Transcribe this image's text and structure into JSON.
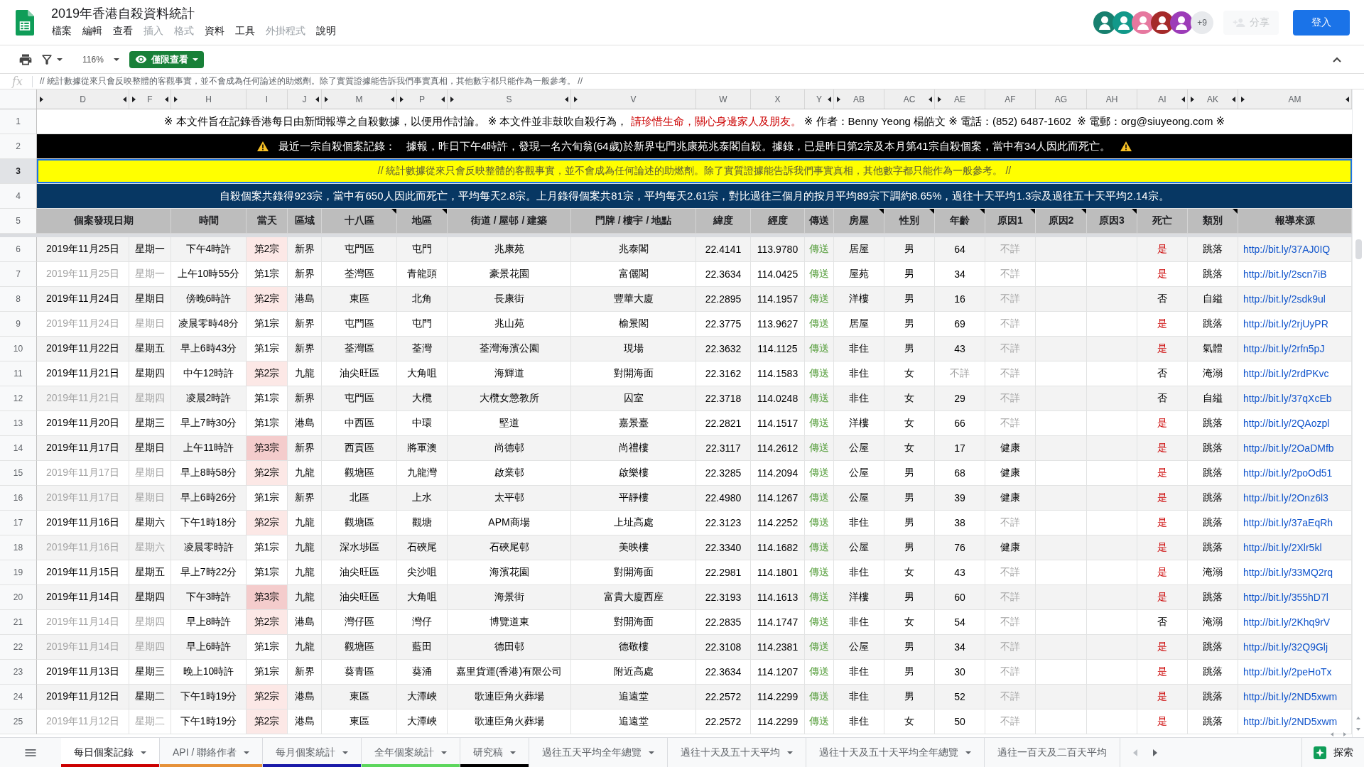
{
  "window": {
    "title": "2019年香港自殺資料統計"
  },
  "menu": [
    {
      "label": "檔案",
      "disabled": false
    },
    {
      "label": "編輯",
      "disabled": false
    },
    {
      "label": "查看",
      "disabled": false
    },
    {
      "label": "插入",
      "disabled": true
    },
    {
      "label": "格式",
      "disabled": true
    },
    {
      "label": "資料",
      "disabled": false
    },
    {
      "label": "工具",
      "disabled": false
    },
    {
      "label": "外掛程式",
      "disabled": true
    },
    {
      "label": "說明",
      "disabled": false
    }
  ],
  "account_bar": {
    "avatars": [
      {
        "color": "#17806f"
      },
      {
        "color": "#12998a"
      },
      {
        "color": "#e6789f"
      },
      {
        "color": "#a52a2a"
      },
      {
        "color": "#9c3cb8"
      }
    ],
    "more_viewers": "+9",
    "share": {
      "label": "分享",
      "disabled": true
    },
    "sign_in": {
      "label": "登入"
    }
  },
  "toolbar": {
    "zoom": "116%",
    "view_mode": "僅限查看"
  },
  "formula_bar": {
    "label": "fx",
    "value": "// 統計數據從來只會反映整體的客觀事實，並不會成為任何論述的助燃劑。除了實質證據能告訴我們事實真相，其他數字都只能作為一般參考。 //"
  },
  "column_headers": [
    {
      "letter": "D",
      "hidden_before": true,
      "hidden_after": true
    },
    {
      "letter": "F",
      "hidden_before": true,
      "hidden_after": true
    },
    {
      "letter": "H",
      "hidden_before": true,
      "hidden_after": false
    },
    {
      "letter": "I",
      "hidden_before": false,
      "hidden_after": false
    },
    {
      "letter": "J",
      "hidden_before": false,
      "hidden_after": true
    },
    {
      "letter": "M",
      "hidden_before": true,
      "hidden_after": true
    },
    {
      "letter": "P",
      "hidden_before": true,
      "hidden_after": true
    },
    {
      "letter": "S",
      "hidden_before": true,
      "hidden_after": true
    },
    {
      "letter": "V",
      "hidden_before": true,
      "hidden_after": false
    },
    {
      "letter": "W",
      "hidden_before": false,
      "hidden_after": false
    },
    {
      "letter": "X",
      "hidden_before": false,
      "hidden_after": false
    },
    {
      "letter": "Y",
      "hidden_before": false,
      "hidden_after": true
    },
    {
      "letter": "AB",
      "hidden_before": true,
      "hidden_after": false
    },
    {
      "letter": "AC",
      "hidden_before": false,
      "hidden_after": true
    },
    {
      "letter": "AE",
      "hidden_before": true,
      "hidden_after": false
    },
    {
      "letter": "AF",
      "hidden_before": false,
      "hidden_after": false
    },
    {
      "letter": "AG",
      "hidden_before": false,
      "hidden_after": false
    },
    {
      "letter": "AH",
      "hidden_before": false,
      "hidden_after": false
    },
    {
      "letter": "AI",
      "hidden_before": false,
      "hidden_after": true
    },
    {
      "letter": "AK",
      "hidden_before": true,
      "hidden_after": true
    },
    {
      "letter": "AM",
      "hidden_before": true,
      "hidden_after": true
    }
  ],
  "banner_rows": [
    {
      "number": "1",
      "kind": "notice",
      "selected": false,
      "segments": [
        {
          "text": "※ 本文件旨在記錄香港每日由新聞報導之自殺數據，以便用作討論。 ※ 本文件並非鼓吹自殺行為， ",
          "emphasis": false
        },
        {
          "text": "請珍惜生命，關心身邊家人及朋友。",
          "emphasis": true
        },
        {
          "text": " ※ 作者：Benny Yeong 楊皓文 ※ 電話：(852) 6487-1602  ※ 電郵：org@siuyeong.com ※",
          "emphasis": false
        }
      ]
    },
    {
      "number": "2",
      "kind": "alert",
      "selected": false,
      "segments": [
        {
          "text": "最近一宗自殺個案記錄：　據報，昨日下午4時許，發現一名六旬翁(64歲)於新界屯門兆康苑兆泰閣自殺。據錄，已是昨日第2宗及本月第41宗自殺個案，當中有34人因此而死亡。",
          "emphasis": false
        }
      ]
    },
    {
      "number": "3",
      "kind": "disclaimer",
      "selected": true,
      "segments": [
        {
          "text": "// 統計數據從來只會反映整體的客觀事實，並不會成為任何論述的助燃劑。除了實質證據能告訴我們事實真相，其他數字都只能作為一般參考。 //",
          "emphasis": false
        }
      ]
    },
    {
      "number": "4",
      "kind": "summary",
      "selected": false,
      "segments": [
        {
          "text": "自殺個案共錄得923宗，當中有650人因此而死亡，平均每天2.8宗。上月錄得個案共81宗，平均每天2.61宗，對比過往三個月的按月平均89宗下調約8.65%，過往十天平均1.3宗及過往五十天平均2.14宗。",
          "emphasis": false
        }
      ]
    }
  ],
  "header_row": {
    "number": "5",
    "cells": [
      {
        "label": "個案發現日期",
        "note": false
      },
      {
        "label": "時間",
        "note": false
      },
      {
        "label": "當天",
        "note": false
      },
      {
        "label": "區域",
        "note": false
      },
      {
        "label": "十八區",
        "note": true
      },
      {
        "label": "地區",
        "note": true
      },
      {
        "label": "街道 / 屋邨 / 建築",
        "note": false
      },
      {
        "label": "門牌 / 樓宇 / 地點",
        "note": false
      },
      {
        "label": "緯度",
        "note": false
      },
      {
        "label": "經度",
        "note": false
      },
      {
        "label": "傳送",
        "note": false
      },
      {
        "label": "房屋",
        "note": true
      },
      {
        "label": "性別",
        "note": true
      },
      {
        "label": "年齡",
        "note": true
      },
      {
        "label": "原因1",
        "note": true
      },
      {
        "label": "原因2",
        "note": true
      },
      {
        "label": "原因3",
        "note": true
      },
      {
        "label": "死亡",
        "note": false
      },
      {
        "label": "類別",
        "note": true
      },
      {
        "label": "報導來源",
        "note": false
      }
    ]
  },
  "rows": [
    {
      "number": "6",
      "date": "2019年11月25日",
      "weekday": "星期一",
      "repeat_date": false,
      "time": "下午4時許",
      "case": {
        "text": "第2宗",
        "color": "#fce8e6"
      },
      "region": "新界",
      "district": "屯門區",
      "area": "屯門",
      "street": "兆康苑",
      "building": "兆泰閣",
      "lat": "22.4141",
      "lon": "113.9780",
      "transfer": "傳送",
      "housing": "居屋",
      "sex": "男",
      "age": "64",
      "age_unknown": false,
      "cause1": "不詳",
      "cause1_unknown": true,
      "death": "是",
      "death_marked": true,
      "type": "跳落",
      "source": "http://bit.ly/37AJ0IQ"
    },
    {
      "number": "7",
      "date": "2019年11月25日",
      "weekday": "星期一",
      "repeat_date": true,
      "time": "上午10時55分",
      "case": {
        "text": "第1宗",
        "color": "#ffffff"
      },
      "region": "新界",
      "district": "荃灣區",
      "area": "青龍頭",
      "street": "豪景花園",
      "building": "富儷閣",
      "lat": "22.3634",
      "lon": "114.0425",
      "transfer": "傳送",
      "housing": "屋苑",
      "sex": "男",
      "age": "34",
      "age_unknown": false,
      "cause1": "不詳",
      "cause1_unknown": true,
      "death": "是",
      "death_marked": true,
      "type": "跳落",
      "source": "http://bit.ly/2scn7iB"
    },
    {
      "number": "8",
      "date": "2019年11月24日",
      "weekday": "星期日",
      "repeat_date": false,
      "time": "傍晚6時許",
      "case": {
        "text": "第2宗",
        "color": "#fce8e6"
      },
      "region": "港島",
      "district": "東區",
      "area": "北角",
      "street": "長康街",
      "building": "豐華大廈",
      "lat": "22.2895",
      "lon": "114.1957",
      "transfer": "傳送",
      "housing": "洋樓",
      "sex": "男",
      "age": "16",
      "age_unknown": false,
      "cause1": "不詳",
      "cause1_unknown": true,
      "death": "否",
      "death_marked": false,
      "type": "自縊",
      "source": "http://bit.ly/2sdk9ul"
    },
    {
      "number": "9",
      "date": "2019年11月24日",
      "weekday": "星期日",
      "repeat_date": true,
      "time": "凌晨零時48分",
      "case": {
        "text": "第1宗",
        "color": "#ffffff"
      },
      "region": "新界",
      "district": "屯門區",
      "area": "屯門",
      "street": "兆山苑",
      "building": "榆景閣",
      "lat": "22.3775",
      "lon": "113.9627",
      "transfer": "傳送",
      "housing": "居屋",
      "sex": "男",
      "age": "69",
      "age_unknown": false,
      "cause1": "不詳",
      "cause1_unknown": true,
      "death": "是",
      "death_marked": true,
      "type": "跳落",
      "source": "http://bit.ly/2rjUyPR"
    },
    {
      "number": "10",
      "date": "2019年11月22日",
      "weekday": "星期五",
      "repeat_date": false,
      "time": "早上6時43分",
      "case": {
        "text": "第1宗",
        "color": "#ffffff"
      },
      "region": "新界",
      "district": "荃灣區",
      "area": "荃灣",
      "street": "荃灣海濱公園",
      "building": "現場",
      "lat": "22.3632",
      "lon": "114.1125",
      "transfer": "傳送",
      "housing": "非住",
      "sex": "男",
      "age": "43",
      "age_unknown": false,
      "cause1": "不詳",
      "cause1_unknown": true,
      "death": "是",
      "death_marked": true,
      "type": "氣體",
      "source": "http://bit.ly/2rfn5pJ"
    },
    {
      "number": "11",
      "date": "2019年11月21日",
      "weekday": "星期四",
      "repeat_date": false,
      "time": "中午12時許",
      "case": {
        "text": "第2宗",
        "color": "#fce8e6"
      },
      "region": "九龍",
      "district": "油尖旺區",
      "area": "大角咀",
      "street": "海輝道",
      "building": "對開海面",
      "lat": "22.3162",
      "lon": "114.1583",
      "transfer": "傳送",
      "housing": "非住",
      "sex": "女",
      "age": "不詳",
      "age_unknown": true,
      "cause1": "不詳",
      "cause1_unknown": true,
      "death": "否",
      "death_marked": false,
      "type": "淹溺",
      "source": "http://bit.ly/2rdPKvc"
    },
    {
      "number": "12",
      "date": "2019年11月21日",
      "weekday": "星期四",
      "repeat_date": true,
      "time": "凌晨2時許",
      "case": {
        "text": "第1宗",
        "color": "#ffffff"
      },
      "region": "新界",
      "district": "屯門區",
      "area": "大欖",
      "street": "大欖女懲教所",
      "building": "囚室",
      "lat": "22.3718",
      "lon": "114.0248",
      "transfer": "傳送",
      "housing": "非住",
      "sex": "女",
      "age": "29",
      "age_unknown": false,
      "cause1": "不詳",
      "cause1_unknown": true,
      "death": "否",
      "death_marked": false,
      "type": "自縊",
      "source": "http://bit.ly/37qXcEb"
    },
    {
      "number": "13",
      "date": "2019年11月20日",
      "weekday": "星期三",
      "repeat_date": false,
      "time": "早上7時30分",
      "case": {
        "text": "第1宗",
        "color": "#ffffff"
      },
      "region": "港島",
      "district": "中西區",
      "area": "中環",
      "street": "堅道",
      "building": "嘉景臺",
      "lat": "22.2821",
      "lon": "114.1517",
      "transfer": "傳送",
      "housing": "洋樓",
      "sex": "女",
      "age": "66",
      "age_unknown": false,
      "cause1": "不詳",
      "cause1_unknown": true,
      "death": "是",
      "death_marked": true,
      "type": "跳落",
      "source": "http://bit.ly/2QAozpl"
    },
    {
      "number": "14",
      "date": "2019年11月17日",
      "weekday": "星期日",
      "repeat_date": false,
      "time": "上午11時許",
      "case": {
        "text": "第3宗",
        "color": "#f4cccc"
      },
      "region": "新界",
      "district": "西貢區",
      "area": "將軍澳",
      "street": "尚德邨",
      "building": "尚禮樓",
      "lat": "22.3117",
      "lon": "114.2612",
      "transfer": "傳送",
      "housing": "公屋",
      "sex": "女",
      "age": "17",
      "age_unknown": false,
      "cause1": "健康",
      "cause1_unknown": false,
      "death": "是",
      "death_marked": true,
      "type": "跳落",
      "source": "http://bit.ly/2OaDMfb"
    },
    {
      "number": "15",
      "date": "2019年11月17日",
      "weekday": "星期日",
      "repeat_date": true,
      "time": "早上8時58分",
      "case": {
        "text": "第2宗",
        "color": "#fce8e6"
      },
      "region": "九龍",
      "district": "觀塘區",
      "area": "九龍灣",
      "street": "啟業邨",
      "building": "啟樂樓",
      "lat": "22.3285",
      "lon": "114.2094",
      "transfer": "傳送",
      "housing": "公屋",
      "sex": "男",
      "age": "68",
      "age_unknown": false,
      "cause1": "健康",
      "cause1_unknown": false,
      "death": "是",
      "death_marked": true,
      "type": "跳落",
      "source": "http://bit.ly/2poOd51"
    },
    {
      "number": "16",
      "date": "2019年11月17日",
      "weekday": "星期日",
      "repeat_date": true,
      "time": "早上6時26分",
      "case": {
        "text": "第1宗",
        "color": "#ffffff"
      },
      "region": "新界",
      "district": "北區",
      "area": "上水",
      "street": "太平邨",
      "building": "平靜樓",
      "lat": "22.4980",
      "lon": "114.1267",
      "transfer": "傳送",
      "housing": "公屋",
      "sex": "男",
      "age": "39",
      "age_unknown": false,
      "cause1": "健康",
      "cause1_unknown": false,
      "death": "是",
      "death_marked": true,
      "type": "跳落",
      "source": "http://bit.ly/2Onz6l3"
    },
    {
      "number": "17",
      "date": "2019年11月16日",
      "weekday": "星期六",
      "repeat_date": false,
      "time": "下午1時18分",
      "case": {
        "text": "第2宗",
        "color": "#fce8e6"
      },
      "region": "九龍",
      "district": "觀塘區",
      "area": "觀塘",
      "street": "APM商場",
      "building": "上址高處",
      "lat": "22.3123",
      "lon": "114.2252",
      "transfer": "傳送",
      "housing": "非住",
      "sex": "男",
      "age": "38",
      "age_unknown": false,
      "cause1": "不詳",
      "cause1_unknown": true,
      "death": "是",
      "death_marked": true,
      "type": "跳落",
      "source": "http://bit.ly/37aEqRh"
    },
    {
      "number": "18",
      "date": "2019年11月16日",
      "weekday": "星期六",
      "repeat_date": true,
      "time": "凌晨零時許",
      "case": {
        "text": "第1宗",
        "color": "#ffffff"
      },
      "region": "九龍",
      "district": "深水埗區",
      "area": "石硤尾",
      "street": "石硤尾邨",
      "building": "美映樓",
      "lat": "22.3340",
      "lon": "114.1682",
      "transfer": "傳送",
      "housing": "公屋",
      "sex": "男",
      "age": "76",
      "age_unknown": false,
      "cause1": "健康",
      "cause1_unknown": false,
      "death": "是",
      "death_marked": true,
      "type": "跳落",
      "source": "http://bit.ly/2Xlr5kl"
    },
    {
      "number": "19",
      "date": "2019年11月15日",
      "weekday": "星期五",
      "repeat_date": false,
      "time": "早上7時22分",
      "case": {
        "text": "第1宗",
        "color": "#ffffff"
      },
      "region": "九龍",
      "district": "油尖旺區",
      "area": "尖沙咀",
      "street": "海濱花園",
      "building": "對開海面",
      "lat": "22.2981",
      "lon": "114.1801",
      "transfer": "傳送",
      "housing": "非住",
      "sex": "女",
      "age": "43",
      "age_unknown": false,
      "cause1": "不詳",
      "cause1_unknown": true,
      "death": "是",
      "death_marked": true,
      "type": "淹溺",
      "source": "http://bit.ly/33MQ2rq"
    },
    {
      "number": "20",
      "date": "2019年11月14日",
      "weekday": "星期四",
      "repeat_date": false,
      "time": "下午3時許",
      "case": {
        "text": "第3宗",
        "color": "#f4cccc"
      },
      "region": "九龍",
      "district": "油尖旺區",
      "area": "大角咀",
      "street": "海景街",
      "building": "富貴大廈西座",
      "lat": "22.3193",
      "lon": "114.1613",
      "transfer": "傳送",
      "housing": "洋樓",
      "sex": "男",
      "age": "60",
      "age_unknown": false,
      "cause1": "不詳",
      "cause1_unknown": true,
      "death": "是",
      "death_marked": true,
      "type": "跳落",
      "source": "http://bit.ly/355hD7l"
    },
    {
      "number": "21",
      "date": "2019年11月14日",
      "weekday": "星期四",
      "repeat_date": true,
      "time": "早上8時許",
      "case": {
        "text": "第2宗",
        "color": "#fce8e6"
      },
      "region": "港島",
      "district": "灣仔區",
      "area": "灣仔",
      "street": "博覽道東",
      "building": "對開海面",
      "lat": "22.2835",
      "lon": "114.1747",
      "transfer": "傳送",
      "housing": "非住",
      "sex": "女",
      "age": "54",
      "age_unknown": false,
      "cause1": "不詳",
      "cause1_unknown": true,
      "death": "否",
      "death_marked": false,
      "type": "淹溺",
      "source": "http://bit.ly/2Khq9rV"
    },
    {
      "number": "22",
      "date": "2019年11月14日",
      "weekday": "星期四",
      "repeat_date": true,
      "time": "早上6時許",
      "case": {
        "text": "第1宗",
        "color": "#ffffff"
      },
      "region": "九龍",
      "district": "觀塘區",
      "area": "藍田",
      "street": "德田邨",
      "building": "德敬樓",
      "lat": "22.3108",
      "lon": "114.2381",
      "transfer": "傳送",
      "housing": "公屋",
      "sex": "男",
      "age": "34",
      "age_unknown": false,
      "cause1": "不詳",
      "cause1_unknown": true,
      "death": "是",
      "death_marked": true,
      "type": "跳落",
      "source": "http://bit.ly/32Q9Glj"
    },
    {
      "number": "23",
      "date": "2019年11月13日",
      "weekday": "星期三",
      "repeat_date": false,
      "time": "晚上10時許",
      "case": {
        "text": "第1宗",
        "color": "#ffffff"
      },
      "region": "新界",
      "district": "葵青區",
      "area": "葵涌",
      "street": "嘉里貨運(香港)有限公司",
      "building": "附近高處",
      "lat": "22.3634",
      "lon": "114.1207",
      "transfer": "傳送",
      "housing": "非住",
      "sex": "男",
      "age": "30",
      "age_unknown": false,
      "cause1": "不詳",
      "cause1_unknown": true,
      "death": "是",
      "death_marked": true,
      "type": "跳落",
      "source": "http://bit.ly/2peHoTx"
    },
    {
      "number": "24",
      "date": "2019年11月12日",
      "weekday": "星期二",
      "repeat_date": false,
      "time": "下午1時19分",
      "case": {
        "text": "第2宗",
        "color": "#fce8e6"
      },
      "region": "港島",
      "district": "東區",
      "area": "大潭峽",
      "street": "歌連臣角火葬場",
      "building": "追遠堂",
      "lat": "22.2572",
      "lon": "114.2299",
      "transfer": "傳送",
      "housing": "非住",
      "sex": "男",
      "age": "52",
      "age_unknown": false,
      "cause1": "不詳",
      "cause1_unknown": true,
      "death": "是",
      "death_marked": true,
      "type": "跳落",
      "source": "http://bit.ly/2ND5xwm"
    },
    {
      "number": "25",
      "date": "2019年11月12日",
      "weekday": "星期二",
      "repeat_date": true,
      "time": "下午1時19分",
      "case": {
        "text": "第2宗",
        "color": "#fce8e6"
      },
      "region": "港島",
      "district": "東區",
      "area": "大潭峽",
      "street": "歌連臣角火葬場",
      "building": "追遠堂",
      "lat": "22.2572",
      "lon": "114.2299",
      "transfer": "傳送",
      "housing": "非住",
      "sex": "女",
      "age": "50",
      "age_unknown": false,
      "cause1": "不詳",
      "cause1_unknown": true,
      "death": "是",
      "death_marked": true,
      "type": "跳落",
      "source": "http://bit.ly/2ND5xwm"
    }
  ],
  "sheet_tabs": [
    {
      "label": "每日個案記錄",
      "selected": true,
      "color": "#cc0000",
      "has_menu": true
    },
    {
      "label": "API / 聯絡作者",
      "selected": false,
      "color": "#e69138",
      "has_menu": true
    },
    {
      "label": "每月個案統計",
      "selected": false,
      "color": "#1a1aa8",
      "has_menu": true
    },
    {
      "label": "全年個案統計",
      "selected": false,
      "color": "#5cd65c",
      "has_menu": true
    },
    {
      "label": "研究稿",
      "selected": false,
      "color": "#000000",
      "has_menu": true
    },
    {
      "label": "過往五天平均全年總覽",
      "selected": false,
      "has_menu": true
    },
    {
      "label": "過往十天及五十天平均",
      "selected": false,
      "has_menu": true
    },
    {
      "label": "過往十天及五十天平均全年總覽",
      "selected": false,
      "has_menu": true
    },
    {
      "label": "過往一百天及二百天平均",
      "selected": false,
      "has_menu": false
    }
  ],
  "explore": {
    "label": "探索"
  }
}
